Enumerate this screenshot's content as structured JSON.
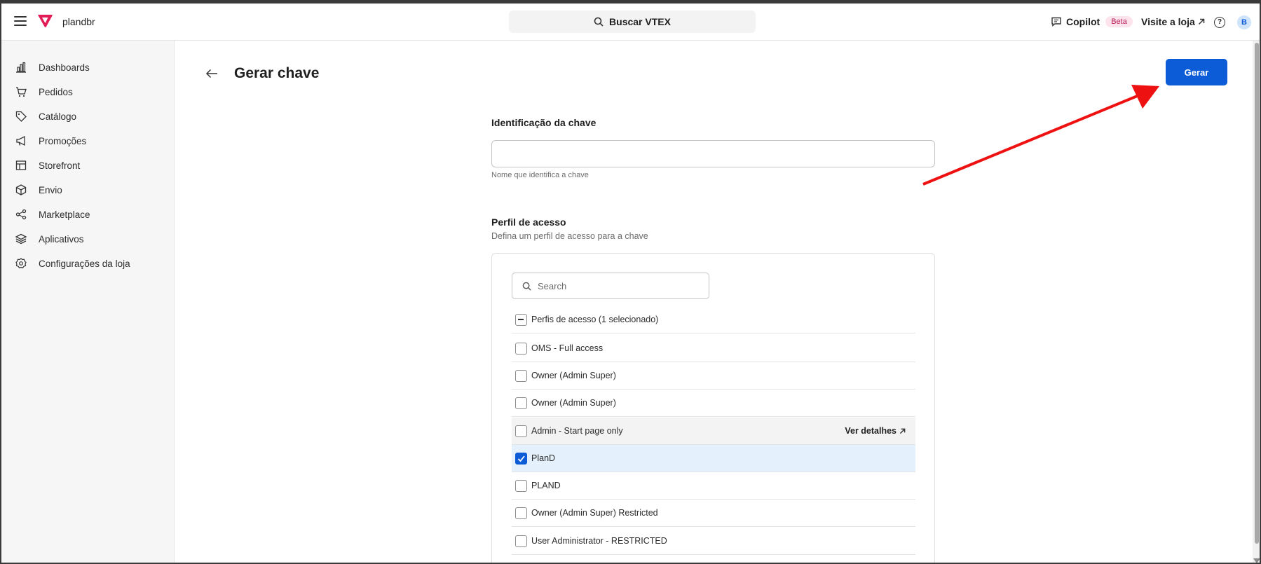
{
  "topbar": {
    "account": "plandbr",
    "search_label": "Buscar VTEX",
    "copilot_label": "Copilot",
    "beta_badge": "Beta",
    "visit_store": "Visite a loja",
    "avatar_initial": "B",
    "brand_color": "#e31c58"
  },
  "sidebar": {
    "items": [
      {
        "label": "Dashboards",
        "icon": "bar-chart-icon"
      },
      {
        "label": "Pedidos",
        "icon": "cart-icon"
      },
      {
        "label": "Catálogo",
        "icon": "tag-icon"
      },
      {
        "label": "Promoções",
        "icon": "megaphone-icon"
      },
      {
        "label": "Storefront",
        "icon": "layout-icon"
      },
      {
        "label": "Envio",
        "icon": "box-icon"
      },
      {
        "label": "Marketplace",
        "icon": "share-icon"
      },
      {
        "label": "Aplicativos",
        "icon": "layers-icon"
      },
      {
        "label": "Configurações da loja",
        "icon": "gear-icon"
      }
    ]
  },
  "main": {
    "title": "Gerar chave",
    "generate_button": "Gerar",
    "accent_color": "#0b5cd6"
  },
  "form": {
    "key_label": "Identificação da chave",
    "key_value": "",
    "key_helper": "Nome que identifica a chave",
    "profile_title": "Perfil de acesso",
    "profile_subtitle": "Defina um perfil de acesso para a chave",
    "search_placeholder": "Search",
    "list_header": "Perfis de acesso (1 selecionado)",
    "details_link": "Ver detalhes",
    "profiles": [
      {
        "label": "OMS - Full access",
        "checked": false
      },
      {
        "label": "Owner (Admin Super)",
        "checked": false
      },
      {
        "label": "Owner (Admin Super)",
        "checked": false
      },
      {
        "label": "Admin - Start page only",
        "checked": false
      },
      {
        "label": "PlanD",
        "checked": true
      },
      {
        "label": "PLAND",
        "checked": false
      },
      {
        "label": "Owner (Admin Super) Restricted",
        "checked": false
      },
      {
        "label": "User Administrator - RESTRICTED",
        "checked": false
      }
    ]
  },
  "annotation_color": "#ee1111"
}
